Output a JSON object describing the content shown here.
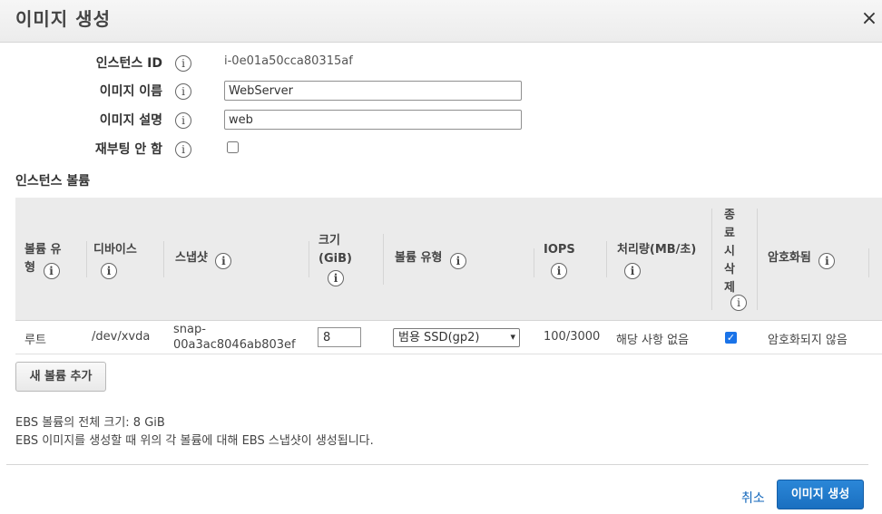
{
  "dialog": {
    "title": "이미지 생성",
    "close_label": "×",
    "info_glyph": "i"
  },
  "form": {
    "instance_id_label": "인스턴스 ID",
    "instance_id_value": "i-0e01a50cca80315af",
    "image_name_label": "이미지 이름",
    "image_name_value": "WebServer",
    "image_desc_label": "이미지 설명",
    "image_desc_value": "web",
    "no_reboot_label": "재부팅 안 함",
    "no_reboot_checked": false
  },
  "volumes": {
    "section_label": "인스턴스 볼륨",
    "headers": {
      "volume_type_line1": "볼륨 유",
      "volume_type_line2": "형",
      "device": "디바이스",
      "snapshot": "스냅샷",
      "size_line1": "크기",
      "size_line2": "(GiB)",
      "ebs_type": "볼륨 유형",
      "iops": "IOPS",
      "throughput": "처리량(MB/초)",
      "delete_c1": "종",
      "delete_c2": "료",
      "delete_c3": "시",
      "delete_c4": "삭",
      "delete_c5": "제",
      "encrypted": "암호화됨"
    },
    "rows": [
      {
        "volume_type": "루트",
        "device": "/dev/xvda",
        "snapshot_line1": "snap-",
        "snapshot_line2": "00a3ac8046ab803ef",
        "size": "8",
        "ebs_type": "범용 SSD(gp2)",
        "iops": "100/3000",
        "throughput": "해당 사항 없음",
        "delete_on_termination": true,
        "encrypted": "암호화되지 않음"
      }
    ],
    "add_button": "새 볼륨 추가"
  },
  "notes": {
    "total_size": "EBS 볼륨의 전체 크기: 8 GiB",
    "snapshot_note": "EBS 이미지를 생성할 때 위의 각 볼륨에 대해 EBS 스냅샷이 생성됩니다."
  },
  "footer": {
    "cancel": "취소",
    "create": "이미지 생성"
  }
}
